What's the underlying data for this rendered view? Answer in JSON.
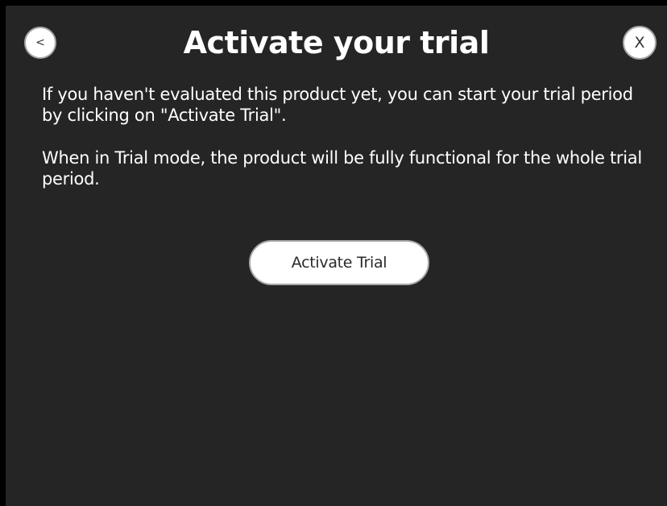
{
  "dialog": {
    "title": "Activate your trial",
    "back_label": "<",
    "close_label": "X",
    "paragraphs": [
      "If you haven't evaluated this product yet, you can start your trial period by clicking on \"Activate Trial\".",
      "When in Trial mode, the product will be fully functional for the whole trial period."
    ],
    "activate_button_label": "Activate Trial"
  },
  "colors": {
    "page_background": "#000000",
    "dialog_background": "#252525",
    "text": "#ffffff",
    "button_background": "#ffffff",
    "button_border": "#a8a8a8",
    "button_text": "#2a2a2a"
  }
}
